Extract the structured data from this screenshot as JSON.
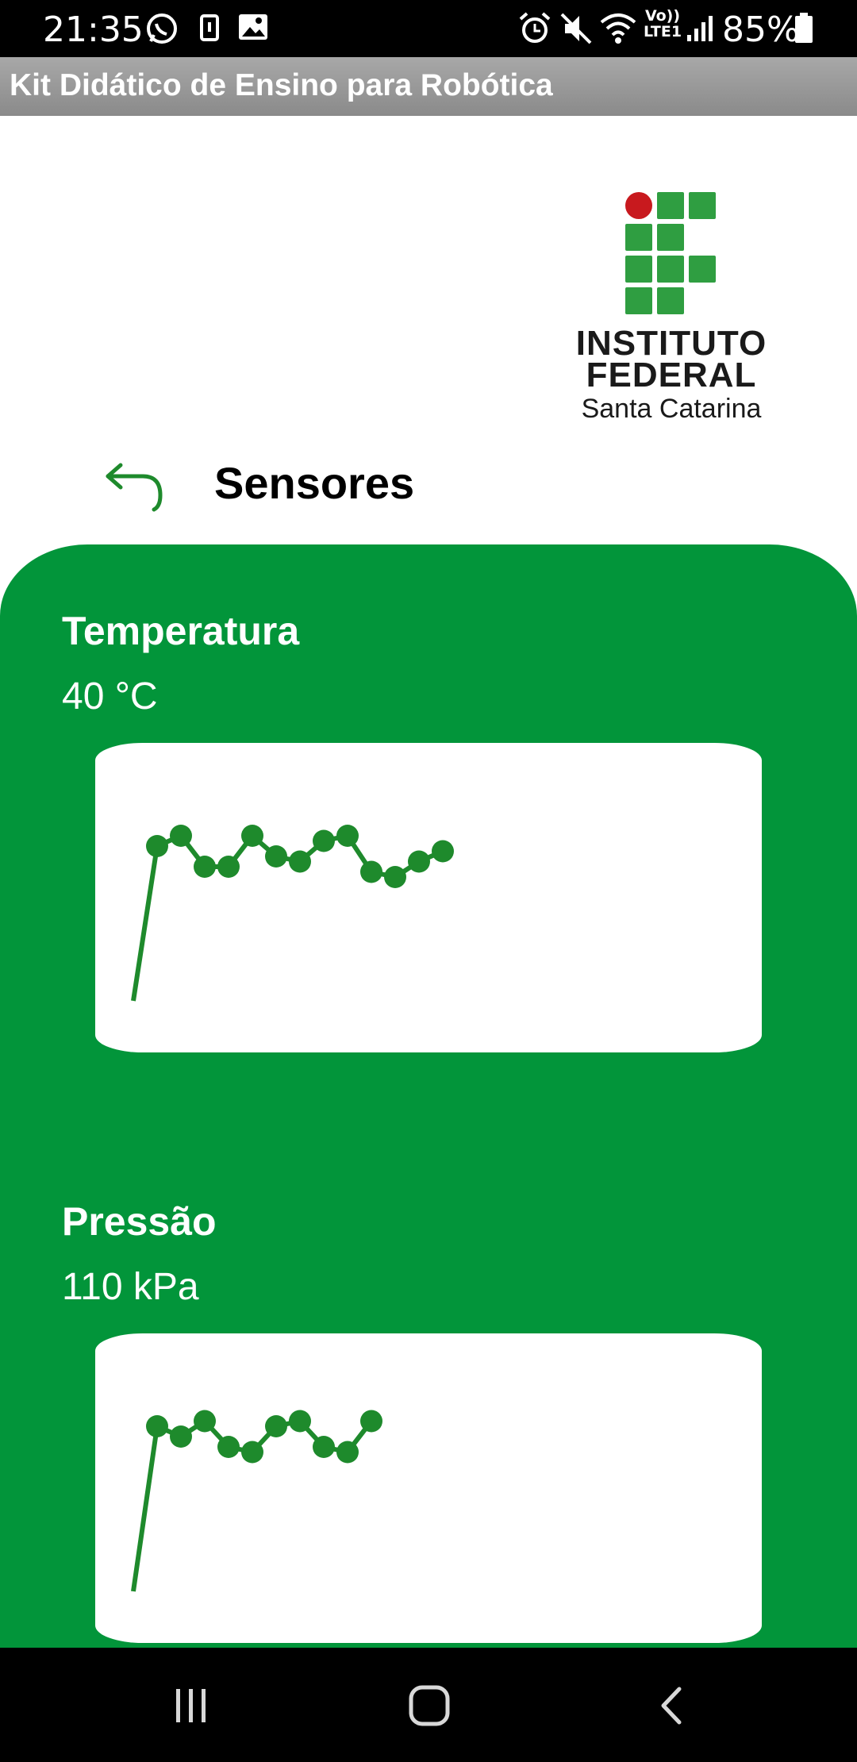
{
  "status_bar": {
    "time": "21:35",
    "battery": "85%",
    "icons": [
      "whatsapp-icon",
      "notification-icon",
      "gallery-icon",
      "alarm-icon",
      "mute-icon",
      "wifi-icon",
      "volte-icon",
      "signal-icon",
      "battery-icon"
    ],
    "lte_label": "LTE1",
    "volte_label": "Vo))"
  },
  "app": {
    "title": "Kit Didático de Ensino para Robótica"
  },
  "logo": {
    "line1": "INSTITUTO",
    "line2": "FEDERAL",
    "line3": "Santa Catarina"
  },
  "header": {
    "title": "Sensores",
    "back_icon": "back-arrow-icon"
  },
  "colors": {
    "green": "#02953a",
    "line": "#1e8a2c",
    "logo_green": "#2f9e41",
    "logo_red": "#c8191e"
  },
  "sensors": [
    {
      "name": "Temperatura",
      "value": "40 °C",
      "chart_data": {
        "type": "line",
        "series": [
          {
            "values": [
              10,
              40,
              42,
              36,
              36,
              42,
              38,
              37,
              41,
              42,
              35,
              34,
              37,
              39
            ]
          }
        ],
        "ylim": [
          0,
          60
        ]
      }
    },
    {
      "name": "Pressão",
      "value": "110  kPa",
      "chart_data": {
        "type": "line",
        "series": [
          {
            "values": [
              10,
              42,
              40,
              43,
              38,
              37,
              42,
              43,
              38,
              37,
              43
            ]
          }
        ],
        "ylim": [
          0,
          60
        ]
      }
    }
  ],
  "nav": {
    "icons": [
      "recent-apps-icon",
      "home-icon",
      "back-icon"
    ]
  }
}
